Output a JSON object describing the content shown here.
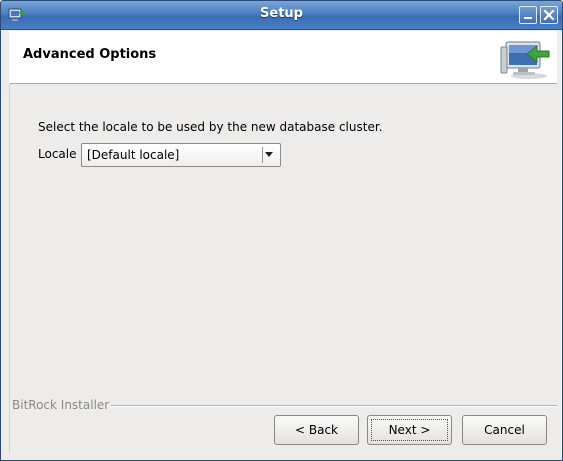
{
  "window": {
    "title": "Setup",
    "app_icon": "installer-app-icon",
    "minimize_icon": "minimize-icon",
    "close_icon": "close-icon",
    "titlebar_color": "#4d7fc2"
  },
  "header": {
    "title": "Advanced Options",
    "logo_icon": "computer-install-icon"
  },
  "content": {
    "description": "Select the locale to be used by the new database cluster.",
    "locale_label": "Locale",
    "locale_value": "[Default locale]"
  },
  "footer": {
    "brand": "BitRock Installer",
    "back_label": "< Back",
    "next_label": "Next >",
    "cancel_label": "Cancel"
  }
}
